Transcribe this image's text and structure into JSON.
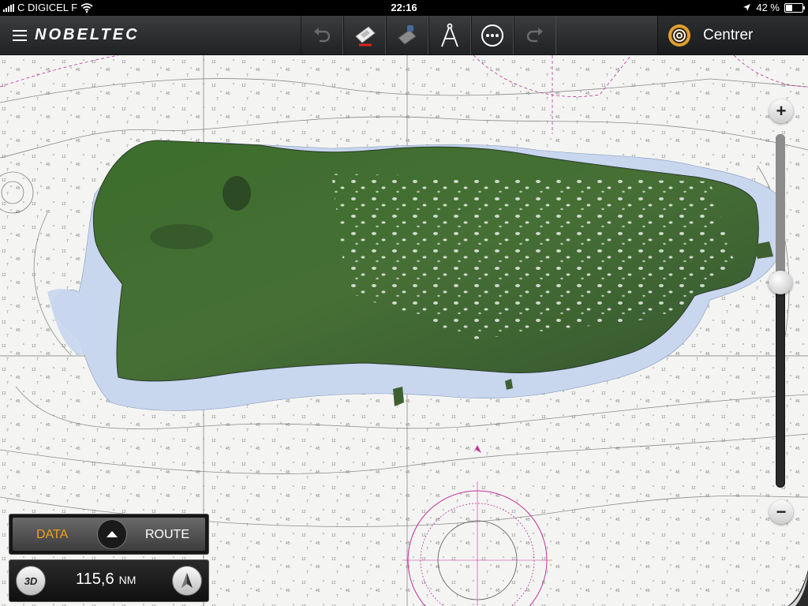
{
  "status_bar": {
    "carrier": "C DIGICEL F",
    "time": "22:16",
    "battery": "42 %",
    "battery_level": 0.42
  },
  "toolbar": {
    "logo": "NOBELTEC",
    "menu_icon": "hamburger-icon",
    "tools": [
      {
        "name": "undo",
        "icon": "undo-arrow-icon"
      },
      {
        "name": "boat",
        "icon": "boat-icon"
      },
      {
        "name": "boat-settings",
        "icon": "boat-gray-icon"
      },
      {
        "name": "measure",
        "icon": "compass-dividers-icon"
      },
      {
        "name": "more",
        "icon": "ellipsis-circle-icon"
      },
      {
        "name": "redo",
        "icon": "redo-arrow-icon"
      }
    ],
    "center_button": {
      "label": "Centrer",
      "icon": "target-icon"
    }
  },
  "map": {
    "type": "nautical-chart-with-satellite-overlay",
    "zoom_level": 0.58,
    "colors": {
      "water_deep": "#f4f5f3",
      "water_shallow": "#c8d6ee",
      "land": "#3f6b30",
      "chart_lines": "#9a9a9a",
      "magenta_marks": "#c2309a"
    }
  },
  "zoom": {
    "in_label": "+",
    "out_label": "−"
  },
  "bottom_panel": {
    "tab_data": "DATA",
    "tab_route": "ROUTE",
    "active_tab": "DATA",
    "btn_3d": "3D",
    "distance_value": "115,6",
    "distance_unit": "NM",
    "compass_icon": "north-arrow-icon"
  }
}
